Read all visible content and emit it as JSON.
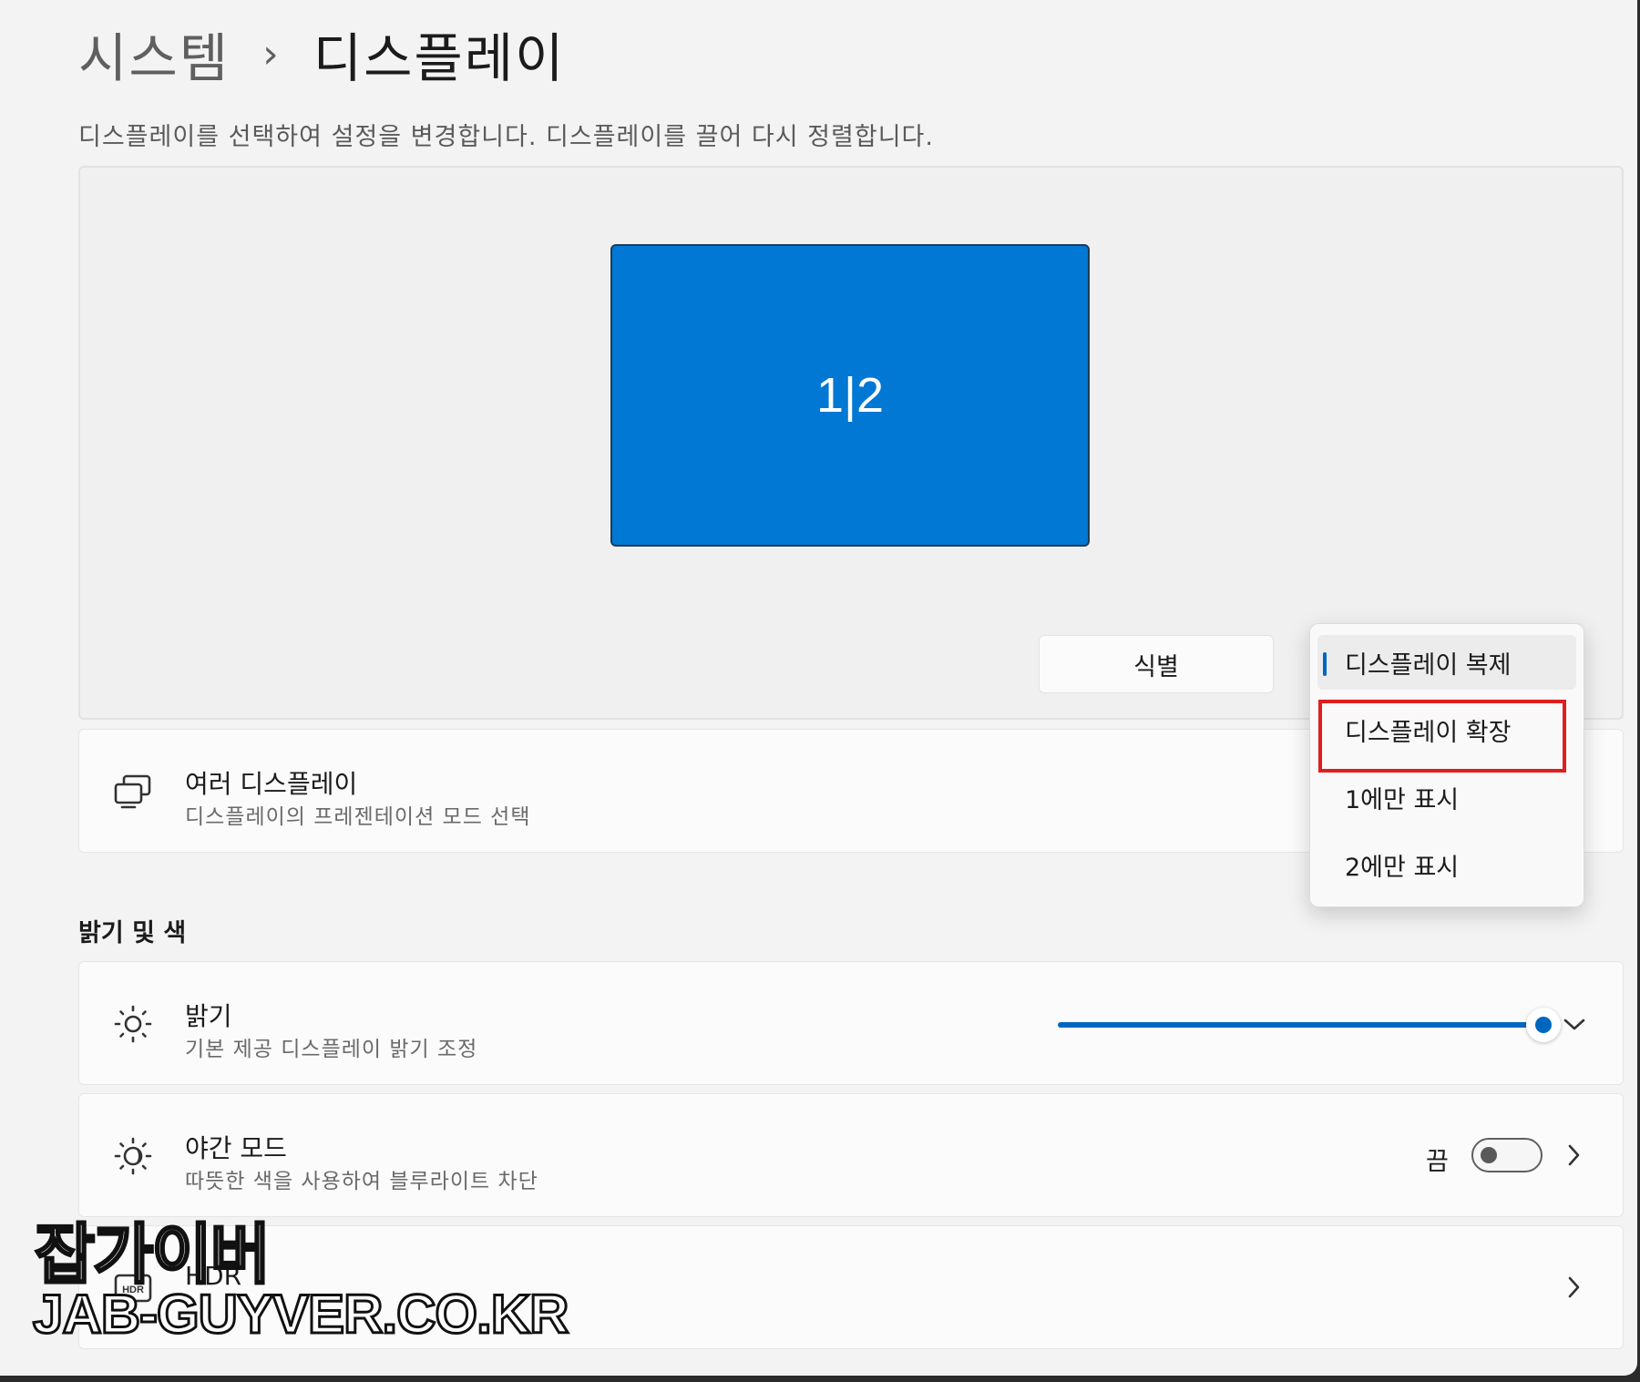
{
  "breadcrumb": {
    "parent": "시스템",
    "separator": "›",
    "current": "디스플레이"
  },
  "description": "디스플레이를 선택하여 설정을 변경합니다. 디스플레이를 끌어 다시 정렬합니다.",
  "arrange": {
    "display_label": "1|2",
    "identify_label": "식별",
    "accent_color": "#0078d4"
  },
  "multiple_displays": {
    "title": "여러 디스플레이",
    "subtitle": "디스플레이의 프레젠테이션 모드 선택",
    "icon": "multiple-displays-icon"
  },
  "dropdown": {
    "options": [
      "디스플레이 복제",
      "디스플레이 확장",
      "1에만 표시",
      "2에만 표시"
    ],
    "selected_index": 0,
    "highlighted_index": 1,
    "highlight_color": "#e01e1e"
  },
  "section_brightness": "밝기 및 색",
  "brightness": {
    "title": "밝기",
    "subtitle": "기본 제공 디스플레이 밝기 조정",
    "value_percent": 100,
    "icon": "sun-icon"
  },
  "night_light": {
    "title": "야간 모드",
    "subtitle": "따뜻한 색을 사용하여 블루라이트 차단",
    "state_label": "끔",
    "on": false,
    "icon": "night-light-icon"
  },
  "hdr": {
    "title": "HDR",
    "icon": "hdr-icon"
  },
  "watermark": {
    "title": "잡가이버",
    "url": "JAB-GUYVER.CO.KR"
  }
}
